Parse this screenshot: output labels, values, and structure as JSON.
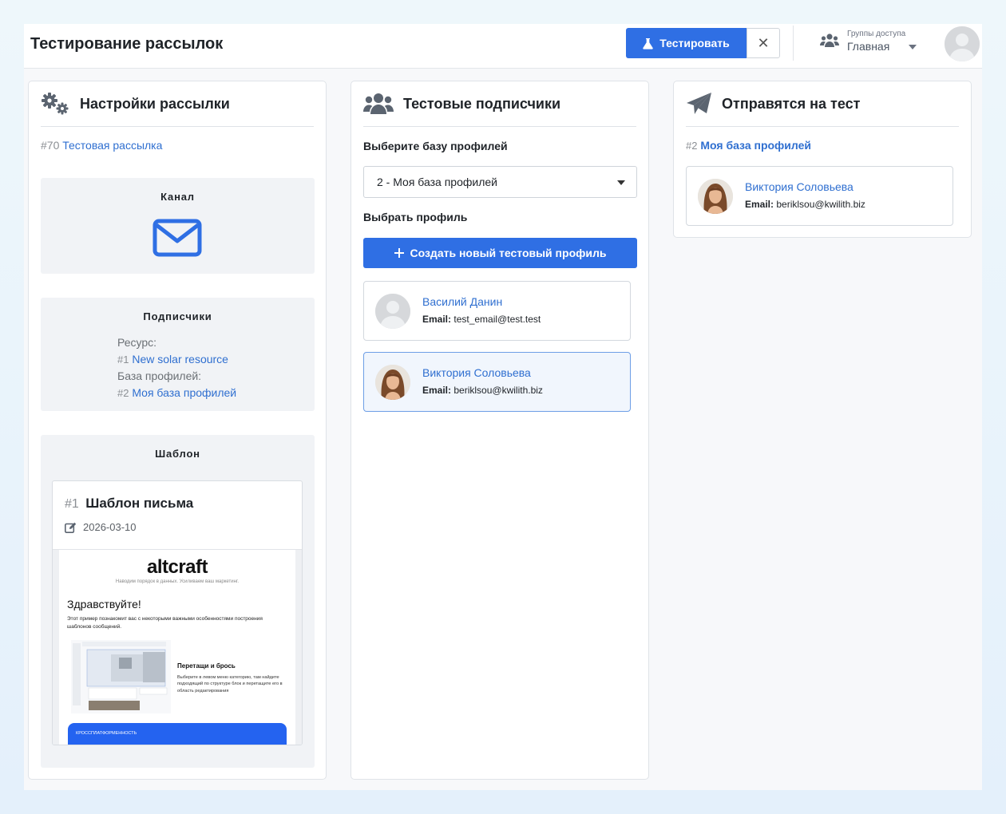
{
  "header": {
    "title": "Тестирование рассылок",
    "test_button": "Тестировать",
    "close_symbol": "✕",
    "access_label": "Группы доступа",
    "access_value": "Главная"
  },
  "settings": {
    "title": "Настройки рассылки",
    "mail_num": "#70",
    "mail_name": "Тестовая рассылка",
    "channel_title": "Канал",
    "channel_icon": "envelope-icon",
    "subs_title": "Подписчики",
    "resource_label": "Ресурс:",
    "resource_num": "#1",
    "resource_name": "New solar resource",
    "base_label": "База профилей:",
    "base_num": "#2",
    "base_name": "Моя база профилей",
    "template_title": "Шаблон",
    "template_num": "#1",
    "template_name": "Шаблон письма",
    "template_date": "2026-03-10"
  },
  "preview": {
    "logo": "altcraft",
    "tagline": "Наводим порядок в данных. Усиливаем ваш маркетинг.",
    "greeting": "Здравствуйте!",
    "intro": "Этот пример познакомит вас с некоторыми важными особенностями построения шаблонов сообщений.",
    "dnd_title": "Перетащи и брось",
    "dnd_text": "Выберите в левом меню категорию, там найдите подходящий по структуре блок и перетащите его в область редактирования",
    "banner": "КРОССПЛАТФОРМЕННОСТЬ"
  },
  "subscribers": {
    "title": "Тестовые подписчики",
    "choose_base_label": "Выберите базу профилей",
    "base_select_value": "2 - Моя база профилей",
    "choose_profile_label": "Выбрать профиль",
    "create_button": "Создать новый тестовый профиль",
    "email_label": "Email:",
    "profiles": [
      {
        "name": "Василий Данин",
        "email": "test_email@test.test",
        "selected": false
      },
      {
        "name": "Виктория Соловьева",
        "email": "beriklsou@kwilith.biz",
        "selected": true
      }
    ]
  },
  "send": {
    "title": "Отправятся на тест",
    "base_num": "#2",
    "base_name": "Моя база профилей",
    "email_label": "Email:",
    "recipient_name": "Виктория Соловьева",
    "recipient_email": "beriklsou@kwilith.biz"
  },
  "colors": {
    "accent": "#2f6fe4",
    "link": "#2f6fd0",
    "icon": "#5b6470"
  }
}
